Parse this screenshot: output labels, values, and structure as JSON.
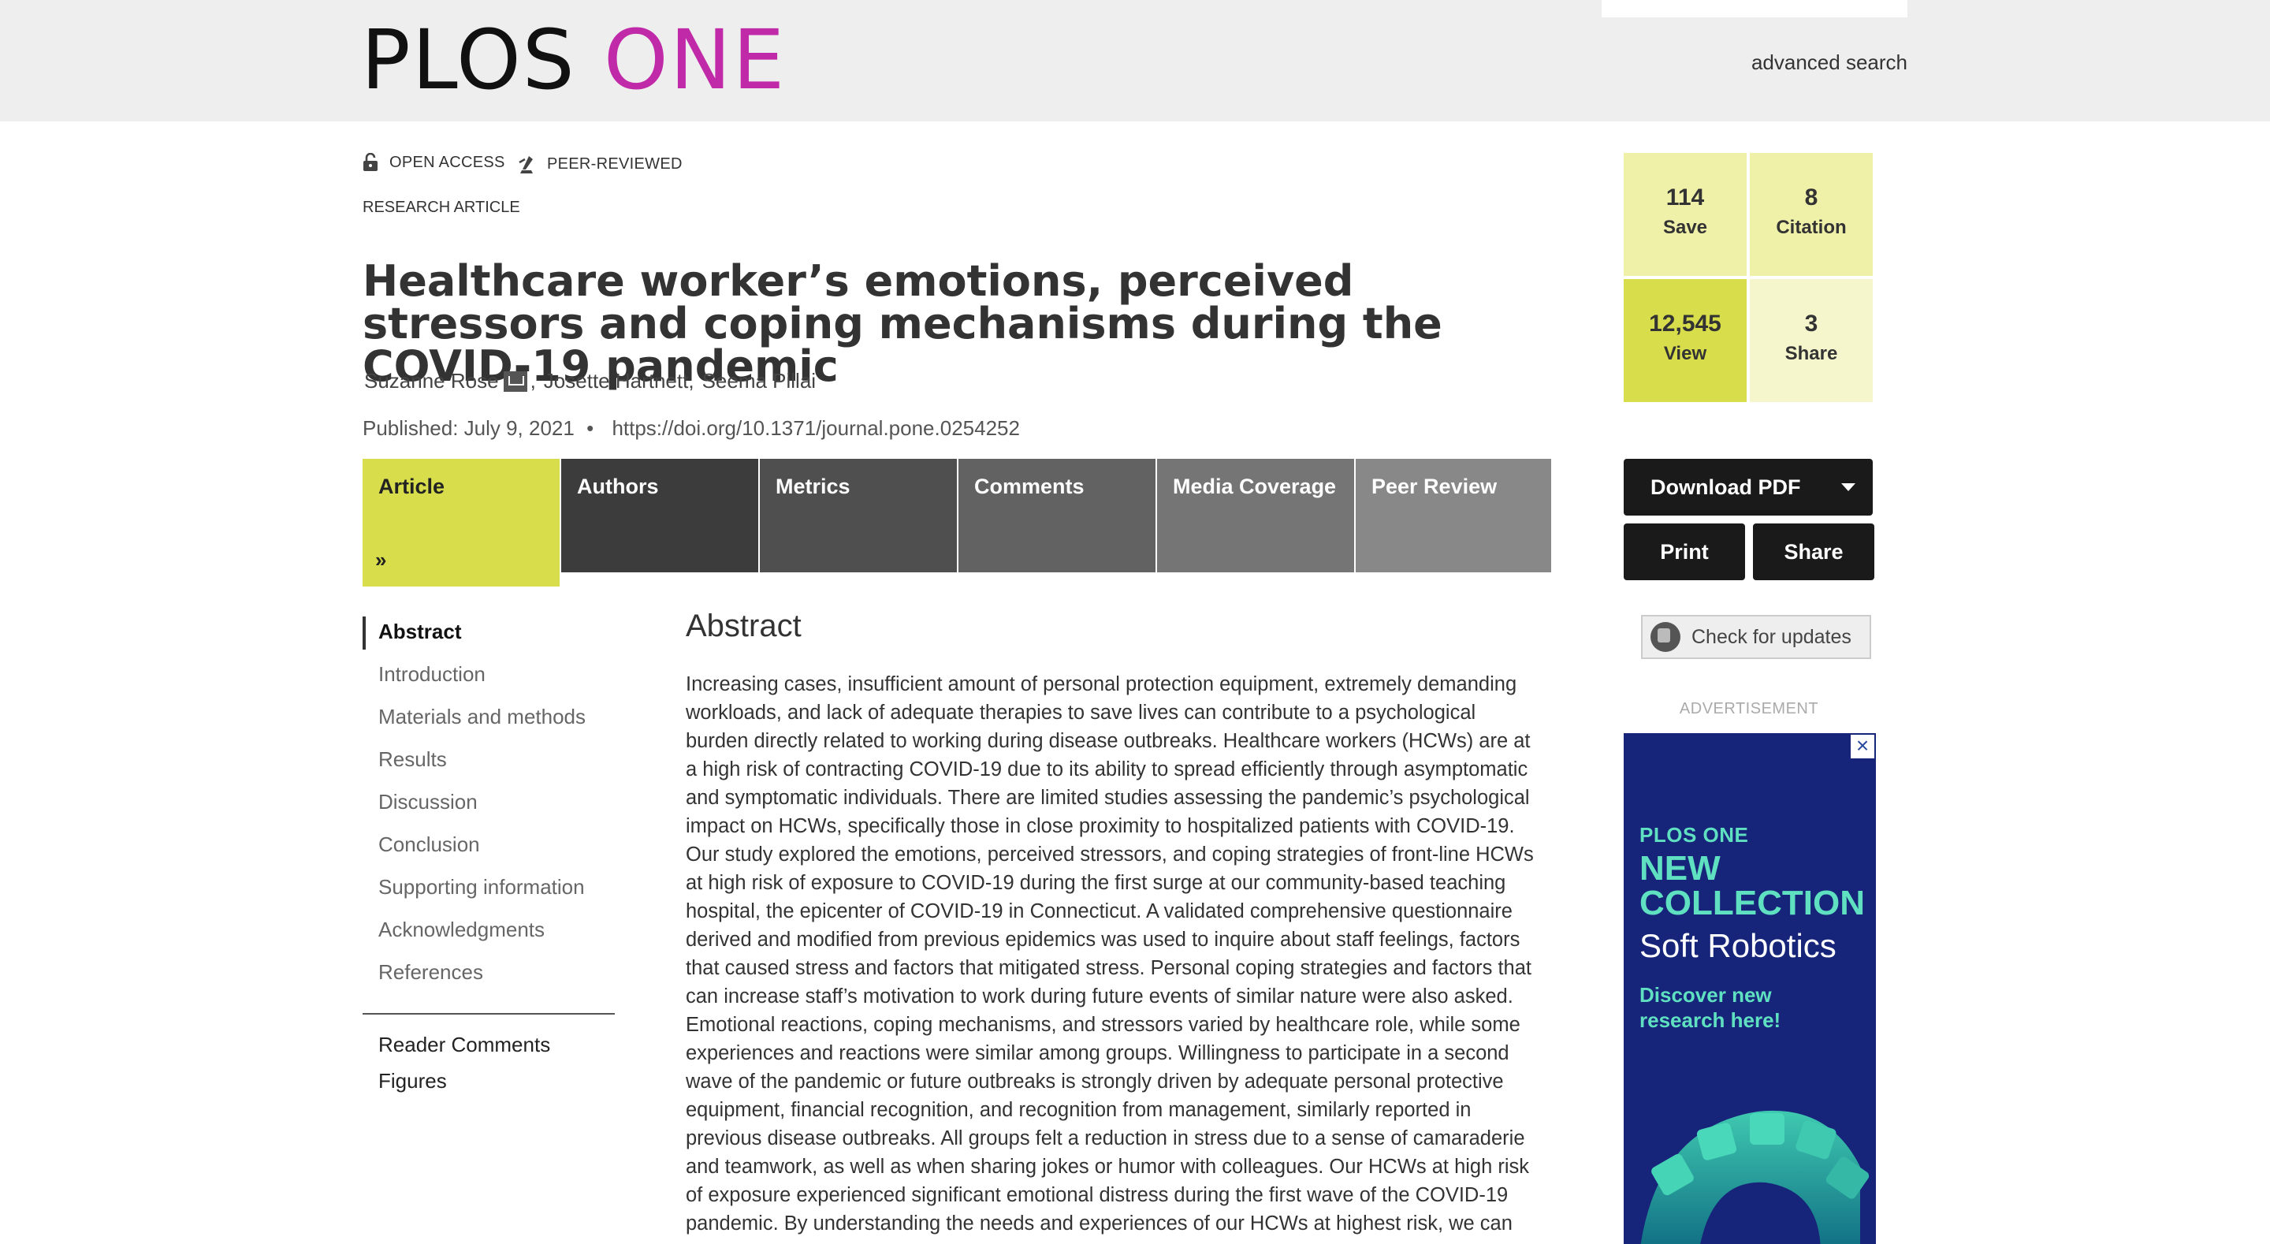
{
  "header": {
    "logo_part1": "PLOS",
    "logo_part2": "ONE",
    "advanced_search": "advanced search"
  },
  "badges": {
    "open_access": "OPEN ACCESS",
    "peer_reviewed": "PEER-REVIEWED",
    "article_type": "RESEARCH ARTICLE"
  },
  "article": {
    "title": "Healthcare worker’s emotions, perceived stressors and coping mechanisms during the COVID-19 pandemic",
    "authors": [
      "Suzanne Rose",
      "Josette Hartnett,",
      "Seema Pillai"
    ],
    "published": "Published: July 9, 2021",
    "dot": "•",
    "doi": "https://doi.org/10.1371/journal.pone.0254252"
  },
  "tabs": [
    {
      "label": "Article",
      "color": "#d8de4b"
    },
    {
      "label": "Authors",
      "color": "#3c3c3c"
    },
    {
      "label": "Metrics",
      "color": "#4f4f4f"
    },
    {
      "label": "Comments",
      "color": "#626262"
    },
    {
      "label": "Media Coverage",
      "color": "#757575"
    },
    {
      "label": "Peer Review",
      "color": "#888888"
    }
  ],
  "toc": {
    "items": [
      "Abstract",
      "Introduction",
      "Materials and methods",
      "Results",
      "Discussion",
      "Conclusion",
      "Supporting information",
      "Acknowledgments",
      "References"
    ],
    "extra": [
      "Reader Comments",
      "Figures"
    ]
  },
  "abstract": {
    "heading": "Abstract",
    "lines": [
      "Increasing cases, insufficient amount of personal protection equipment, extremely demanding",
      "workloads, and lack of adequate therapies to save lives can contribute to a psychological",
      "burden directly related to working during disease outbreaks. Healthcare workers (HCWs) are at",
      "a high risk of contracting COVID-19 due to its ability to spread efficiently through asymptomatic",
      "and symptomatic individuals. There are limited studies assessing the pandemic’s psychological",
      "impact on HCWs, specifically those in close proximity to hospitalized patients with COVID-19.",
      "Our study explored the emotions, perceived stressors, and coping strategies of front-line HCWs",
      "at high risk of exposure to COVID-19 during the first surge at our community-based teaching",
      "hospital, the epicenter of COVID-19 in Connecticut. A validated comprehensive questionnaire",
      "derived and modified from previous epidemics was used to inquire about staff feelings, factors",
      "that caused stress and factors that mitigated stress. Personal coping strategies and factors that",
      "can increase staff’s motivation to work during future events of similar nature were also asked.",
      "Emotional reactions, coping mechanisms, and stressors varied by healthcare role, while some",
      "experiences and reactions were similar among groups. Willingness to participate in a second",
      "wave of the pandemic or future outbreaks is strongly driven by adequate personal protective",
      "equipment, financial recognition, and recognition from management, similarly reported in",
      "previous disease outbreaks. All groups felt a reduction in stress due to a sense of camaraderie",
      "and teamwork, as well as when sharing jokes or humor with colleagues. Our HCWs at high risk",
      "of exposure experienced significant emotional distress during the first wave of the COVID-19",
      "pandemic. By understanding the needs and experiences of our HCWs at highest risk, we can"
    ]
  },
  "metrics": {
    "save": {
      "value": "114",
      "label": "Save"
    },
    "citation": {
      "value": "8",
      "label": "Citation"
    },
    "view": {
      "value": "12,545",
      "label": "View"
    },
    "share": {
      "value": "3",
      "label": "Share"
    }
  },
  "actions": {
    "download_pdf": "Download PDF",
    "print": "Print",
    "share": "Share",
    "check_updates": "Check for updates"
  },
  "ad": {
    "label": "ADVERTISEMENT",
    "close": "×",
    "brand": "PLOS ONE",
    "headline_1": "NEW",
    "headline_2": "COLLECTION",
    "topic": "Soft Robotics",
    "cta": "Discover new research here!"
  }
}
